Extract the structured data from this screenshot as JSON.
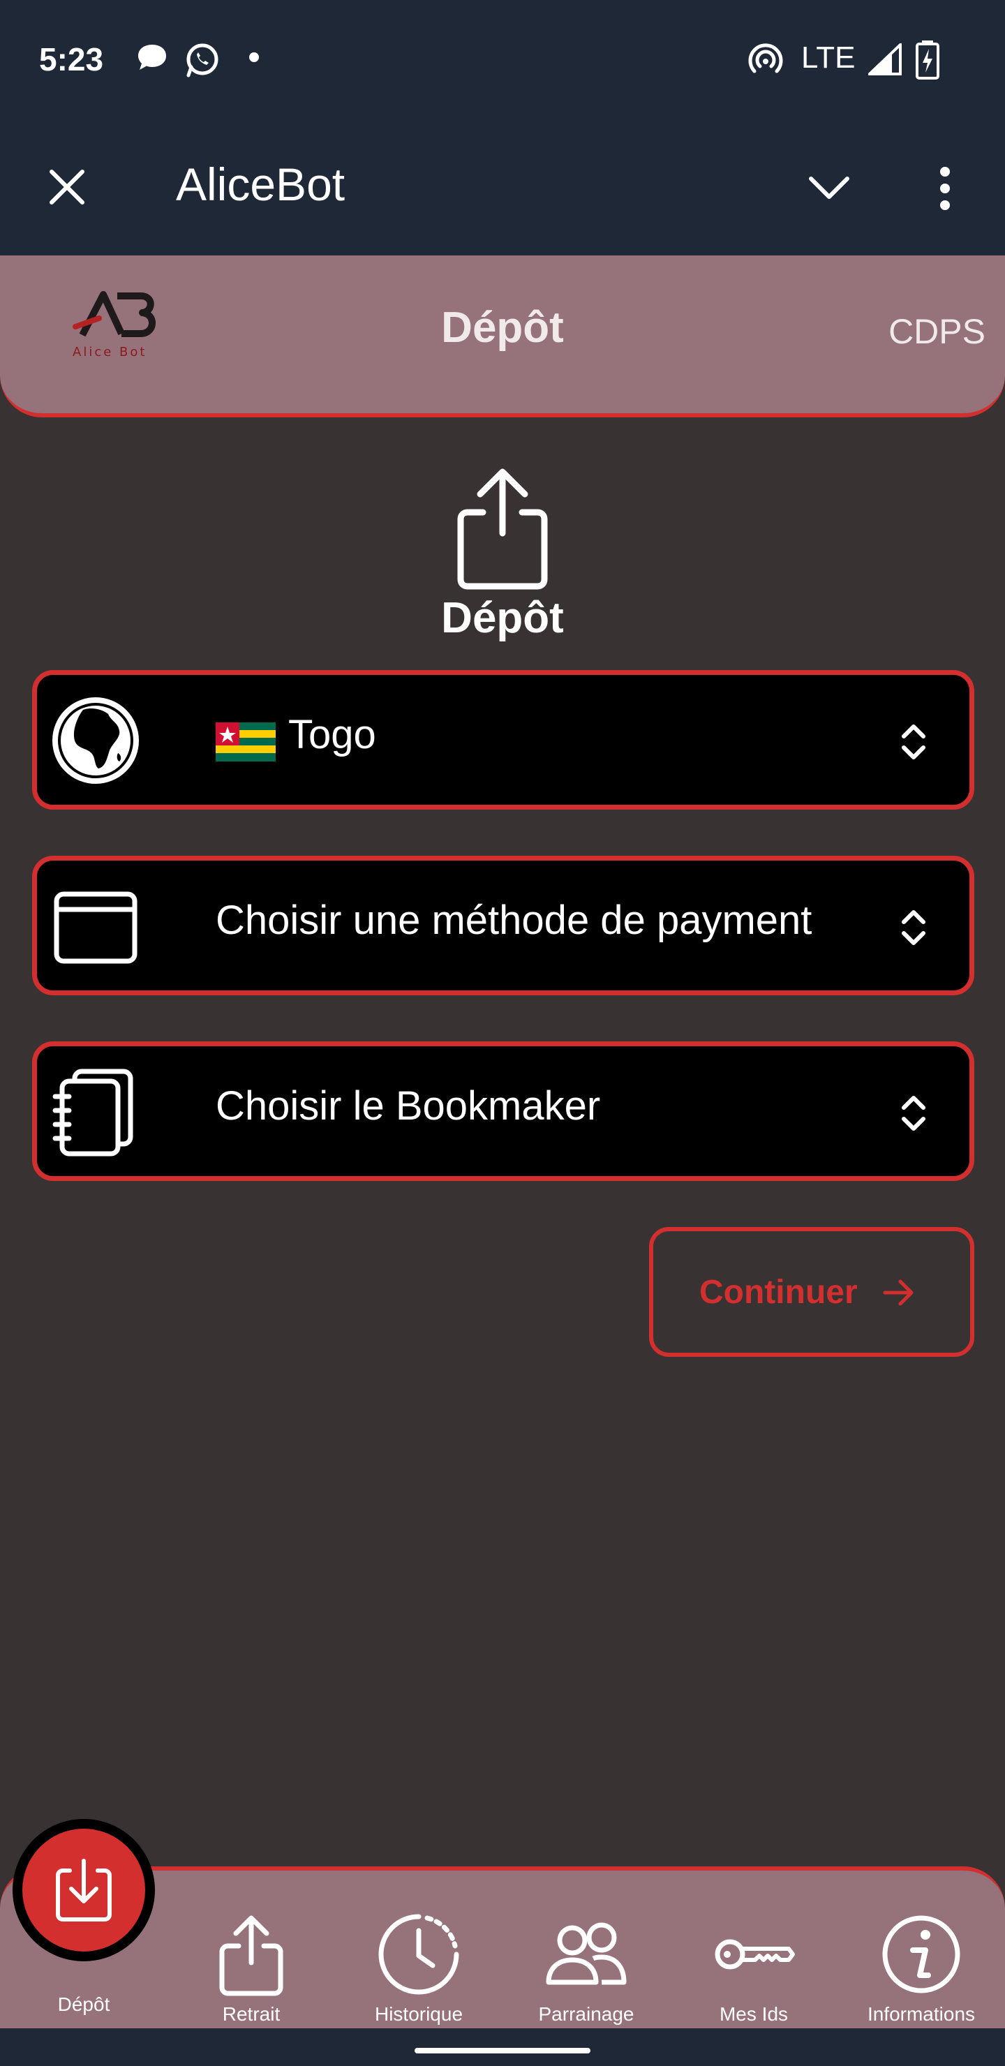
{
  "status_bar": {
    "time": "5:23",
    "network": "LTE",
    "icons": [
      "chat-bubble-icon",
      "whatsapp-icon",
      "dot-icon",
      "hotspot-icon",
      "signal-icon",
      "battery-charging-icon"
    ]
  },
  "app_bar": {
    "title": "AliceBot",
    "icons": [
      "close-icon",
      "chevron-down-icon",
      "more-vert-icon"
    ]
  },
  "page_header": {
    "title": "Dépôt",
    "right_text": "CDPS",
    "logo_text": "Alice Bot"
  },
  "main": {
    "hero_label": "Dépôt",
    "fields": [
      {
        "icon": "globe-africa-icon",
        "value": "Togo",
        "flag": "togo-flag"
      },
      {
        "icon": "card-icon",
        "value": "Choisir une méthode de payment"
      },
      {
        "icon": "notebook-icon",
        "value": "Choisir le Bookmaker"
      }
    ],
    "continue_label": "Continuer"
  },
  "bottom_nav": {
    "items": [
      {
        "label": "Dépôt",
        "icon": "download-icon",
        "active": true
      },
      {
        "label": "Retrait",
        "icon": "upload-icon"
      },
      {
        "label": "Historique",
        "icon": "clock-icon"
      },
      {
        "label": "Parrainage",
        "icon": "people-icon"
      },
      {
        "label": "Mes Ids",
        "icon": "key-icon"
      },
      {
        "label": "Informations",
        "icon": "info-icon"
      }
    ]
  },
  "colors": {
    "accent": "#d32f2f",
    "header_bg": "#96727a",
    "page_bg": "#383233",
    "bar_bg": "#1f2837"
  }
}
